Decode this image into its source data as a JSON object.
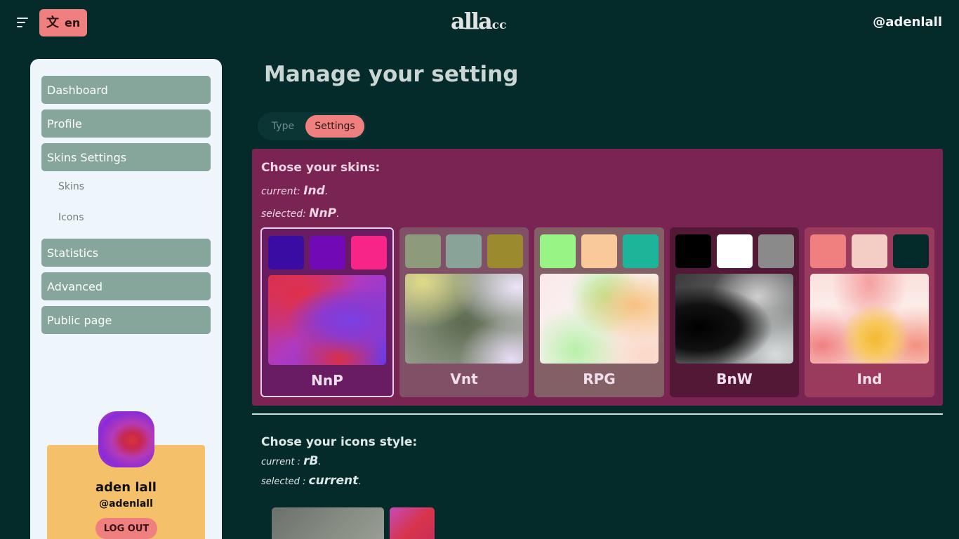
{
  "header": {
    "language_label": "en",
    "logo_main": "alla",
    "logo_sub": "cc",
    "username": "@adenlall"
  },
  "sidebar": {
    "items": [
      {
        "label": "Dashboard"
      },
      {
        "label": "Profile"
      },
      {
        "label": "Skins Settings"
      },
      {
        "label": "Statistics"
      },
      {
        "label": "Advanced"
      },
      {
        "label": "Public page"
      }
    ],
    "sub_items": [
      {
        "label": "Skins"
      },
      {
        "label": "Icons"
      }
    ],
    "profile": {
      "name": "aden lall",
      "handle": "@adenlall",
      "logout_label": "LOG OUT"
    }
  },
  "main": {
    "title": "Manage your setting",
    "tabs": [
      {
        "label": "Type",
        "active": false
      },
      {
        "label": "Settings",
        "active": true
      }
    ],
    "skins": {
      "heading": "Chose your skins:",
      "current_prefix": "current:",
      "current_value": "Ind",
      "selected_prefix": "selected:",
      "selected_value": "NnP",
      "suffix": ".",
      "options": [
        {
          "name": "NnP",
          "selected": true,
          "colors": [
            "#3a0ca3",
            "#7209b7",
            "#f72585"
          ],
          "card_bg": "#6a1c63"
        },
        {
          "name": "Vnt",
          "selected": false,
          "colors": [
            "#8e9b7a",
            "#8aa399",
            "#9c8a2f"
          ],
          "card_bg": "#7f5066"
        },
        {
          "name": "RPG",
          "selected": false,
          "colors": [
            "#98f585",
            "#f9c99a",
            "#1cb59a"
          ],
          "card_bg": "#836065"
        },
        {
          "name": "BnW",
          "selected": false,
          "colors": [
            "#000000",
            "#ffffff",
            "#8a8a8a"
          ],
          "card_bg": "#521835"
        },
        {
          "name": "Ind",
          "selected": false,
          "colors": [
            "#f08080",
            "#f4cdc4",
            "#052a2a"
          ],
          "card_bg": "#9a3a5c"
        }
      ]
    },
    "icons": {
      "heading": "Chose your icons style:",
      "current_prefix": "current :",
      "current_value": "rB",
      "selected_prefix": "selected :",
      "selected_value": "current",
      "suffix": "."
    }
  }
}
